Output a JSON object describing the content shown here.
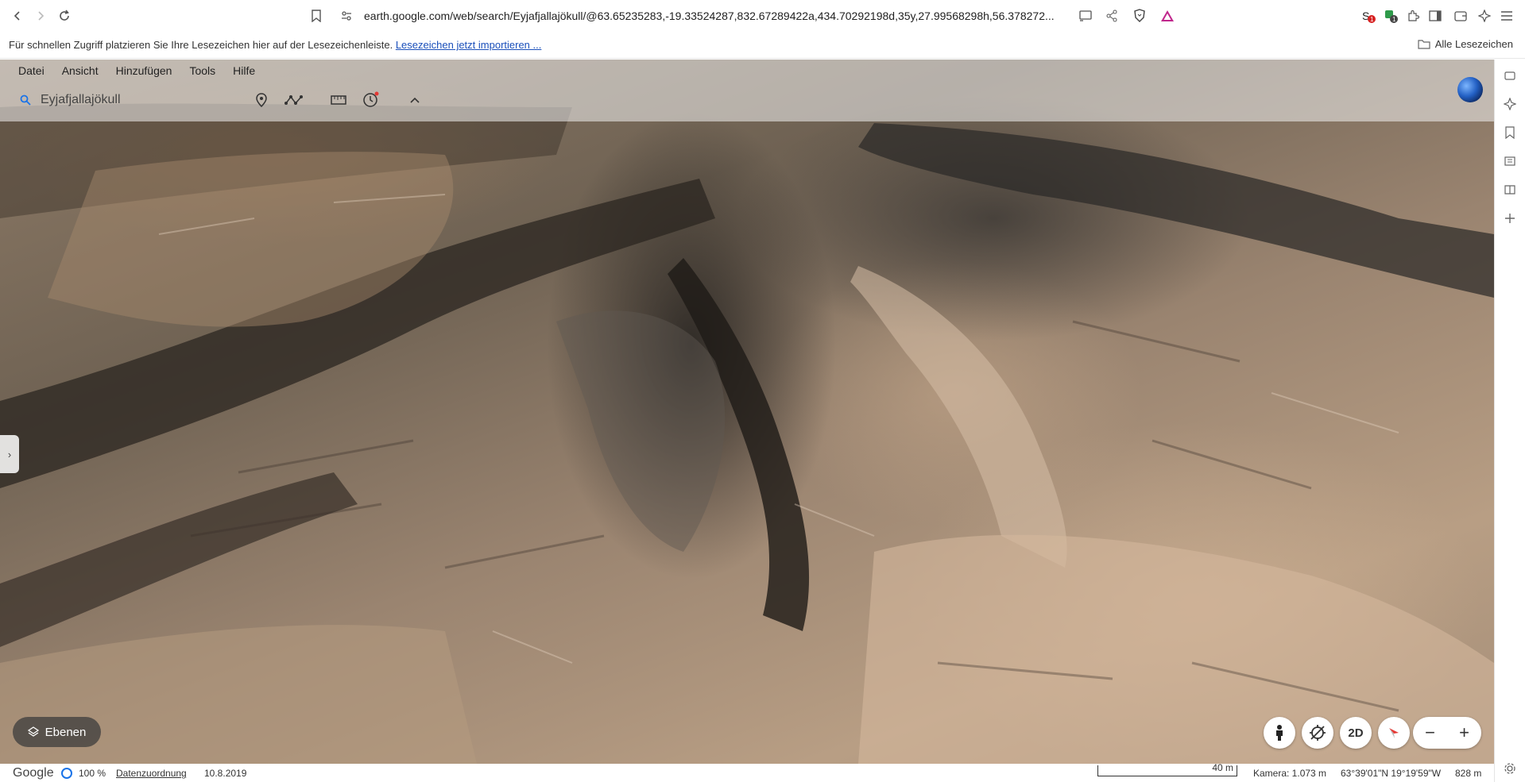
{
  "browser": {
    "url": "earth.google.com/web/search/Eyjafjallajökull/@63.65235283,-19.33524287,832.67289422a,434.70292198d,35y,27.99568298h,56.378272...",
    "bookmark_hint": "Für schnellen Zugriff platzieren Sie Ihre Lesezeichen hier auf der Lesezeichenleiste.",
    "bookmark_import_link": "Lesezeichen jetzt importieren ...",
    "all_bookmarks": "Alle Lesezeichen",
    "ext_badge_1": "1",
    "ext_badge_2": "1"
  },
  "earth": {
    "menu": [
      "Datei",
      "Ansicht",
      "Hinzufügen",
      "Tools",
      "Hilfe"
    ],
    "search": {
      "value": "Eyjafjallajökull"
    },
    "tools": [
      "placemark-icon",
      "path-icon",
      "ruler-icon",
      "history-icon",
      "collapse-up-icon"
    ],
    "layers_label": "Ebenen",
    "view_mode_label": "2D",
    "zoom_out_label": "−",
    "zoom_in_label": "+"
  },
  "status": {
    "brand": "Google",
    "load_percent": "100 %",
    "attribution": "Datenzuordnung",
    "imagery_date": "10.8.2019",
    "scale": "40 m",
    "camera": "Kamera: 1.073 m",
    "coordinates": "63°39'01\"N 19°19'59\"W",
    "elevation": "828 m"
  },
  "colors": {
    "accent": "#1a73e8",
    "link": "#1a4fba",
    "terrain_dark": "#2a2522",
    "terrain_light": "#c8ad92"
  }
}
